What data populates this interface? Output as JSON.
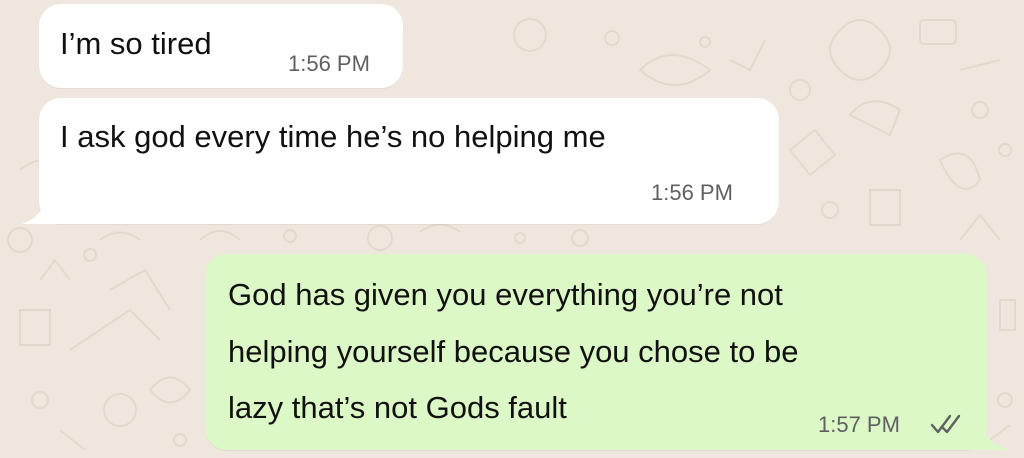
{
  "chat": {
    "messages": [
      {
        "direction": "incoming",
        "text": "I’m so tired",
        "time": "1:56 PM"
      },
      {
        "direction": "incoming",
        "text": "I ask god every time he’s no helping me",
        "time": "1:56 PM"
      },
      {
        "direction": "outgoing",
        "lines": [
          "God has given you everything you’re not",
          "helping yourself because you chose to be",
          "lazy that’s not Gods fault"
        ],
        "time": "1:57 PM",
        "status_icon": "double-check-icon",
        "status": "read"
      }
    ]
  },
  "colors": {
    "wallpaper": "#efe7de",
    "incoming_bubble": "#ffffff",
    "outgoing_bubble": "#dcf8c6",
    "timestamp": "#606060",
    "read_ticks": "#606060"
  }
}
